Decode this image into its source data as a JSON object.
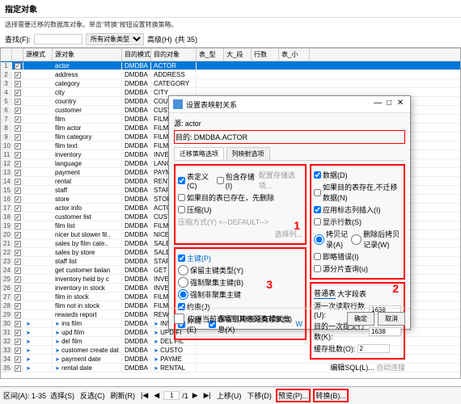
{
  "window": {
    "title": "指定对象",
    "subtitle": "选择需要迁移的数据库对象。单击\"转换\"按钮设置转换策略。"
  },
  "toolbar": {
    "find_label": "查找(F):",
    "scope_label": "所有对象类型",
    "advanced": "高级(H)",
    "count": "(共 35)"
  },
  "headers": [
    "",
    "",
    "源模式",
    "源对象",
    "目的模式",
    "目的对象",
    "表_型",
    "大_段",
    "行数",
    "表_小"
  ],
  "rows": [
    {
      "n": "1",
      "s": "s",
      "sm": "",
      "so": "actor",
      "dm": "DMDBA",
      "do": "ACTOR"
    },
    {
      "n": "2",
      "sm": "",
      "so": "address",
      "dm": "DMDBA",
      "do": "ADDRESS"
    },
    {
      "n": "3",
      "sm": "",
      "so": "category",
      "dm": "DMDBA",
      "do": "CATEGORY"
    },
    {
      "n": "4",
      "sm": "",
      "so": "city",
      "dm": "DMDBA",
      "do": "CITY"
    },
    {
      "n": "5",
      "sm": "",
      "so": "country",
      "dm": "DMDBA",
      "do": "COUNTRY"
    },
    {
      "n": "6",
      "sm": "",
      "so": "customer",
      "dm": "DMDBA",
      "do": "CUSTOMER"
    },
    {
      "n": "7",
      "sm": "",
      "so": "film",
      "dm": "DMDBA",
      "do": "FILM"
    },
    {
      "n": "8",
      "sm": "",
      "so": "film actor",
      "dm": "DMDBA",
      "do": "FILM A..."
    },
    {
      "n": "9",
      "sm": "",
      "so": "film category",
      "dm": "DMDBA",
      "do": "FILM C"
    },
    {
      "n": "10",
      "sm": "",
      "so": "film text",
      "dm": "DMDBA",
      "do": "FILM T"
    },
    {
      "n": "11",
      "sm": "",
      "so": "inventory",
      "dm": "DMDBA",
      "do": "INVENT"
    },
    {
      "n": "12",
      "sm": "",
      "so": "language",
      "dm": "DMDBA",
      "do": "LANGU"
    },
    {
      "n": "13",
      "sm": "",
      "so": "payment",
      "dm": "DMDBA",
      "do": "PAYME"
    },
    {
      "n": "14",
      "sm": "",
      "so": "rental",
      "dm": "DMDBA",
      "do": "RENTAL"
    },
    {
      "n": "15",
      "sm": "",
      "so": "staff",
      "dm": "DMDBA",
      "do": "STAFF"
    },
    {
      "n": "16",
      "sm": "",
      "so": "store",
      "dm": "DMDBA",
      "do": "STORE"
    },
    {
      "n": "17",
      "sm": "",
      "so": "actor info",
      "dm": "DMDBA",
      "do": "ACTOR"
    },
    {
      "n": "18",
      "sm": "",
      "so": "customer list",
      "dm": "DMDBA",
      "do": "CUSTO"
    },
    {
      "n": "19",
      "sm": "",
      "so": "film list",
      "dm": "DMDBA",
      "do": "FILM LI"
    },
    {
      "n": "20",
      "sm": "",
      "so": "nicer but slower fil..",
      "dm": "DMDBA",
      "do": "NICER"
    },
    {
      "n": "21",
      "sm": "",
      "so": "sales by film cate..",
      "dm": "DMDBA",
      "do": "SALES"
    },
    {
      "n": "22",
      "sm": "",
      "so": "sales by store",
      "dm": "DMDBA",
      "do": "SALES"
    },
    {
      "n": "23",
      "sm": "",
      "so": "staff list",
      "dm": "DMDBA",
      "do": "STAFF"
    },
    {
      "n": "24",
      "sm": "",
      "so": "get customer balan",
      "dm": "DMDBA",
      "do": "GET C"
    },
    {
      "n": "25",
      "sm": "",
      "so": "inventory held by c",
      "dm": "DMDBA",
      "do": "INVENT"
    },
    {
      "n": "26",
      "sm": "",
      "so": "inventory in stock",
      "dm": "DMDBA",
      "do": "INVENT"
    },
    {
      "n": "27",
      "sm": "",
      "so": "film in stock",
      "dm": "DMDBA",
      "do": "FILM I"
    },
    {
      "n": "28",
      "sm": "",
      "so": "film not in stock",
      "dm": "DMDBA",
      "do": "FILM N"
    },
    {
      "n": "29",
      "sm": "",
      "so": "rewards report",
      "dm": "DMDBA",
      "do": "REWAR"
    },
    {
      "n": "30",
      "sm": "",
      "so": "ins film",
      "dm": "DMDBA",
      "do": "INS FIL",
      "ar": "1"
    },
    {
      "n": "31",
      "sm": "",
      "so": "upd film",
      "dm": "DMDBA",
      "do": "UPD FI",
      "ar": "1"
    },
    {
      "n": "32",
      "sm": "",
      "so": "del film",
      "dm": "DMDBA",
      "do": "DEL FIL",
      "ar": "1"
    },
    {
      "n": "33",
      "sm": "",
      "so": "customer create dat",
      "dm": "DMDBA",
      "do": "CUSTO",
      "ar": "1"
    },
    {
      "n": "34",
      "sm": "",
      "so": "payment date",
      "dm": "DMDBA",
      "do": "PAYME",
      "ar": "1"
    },
    {
      "n": "35",
      "sm": "",
      "so": "rental date",
      "dm": "DMDBA",
      "do": "RENTAL",
      "ar": "1"
    }
  ],
  "dialog": {
    "title": "设置表映射关系",
    "source_label": "源:",
    "source_value": "actor",
    "dest_label": "目的:",
    "dest_value": "DMDBA.ACTOR",
    "tab1": "迁移策略选项",
    "tab2": "列映射选项",
    "g1": {
      "c1": "表定义(C)",
      "c2": "包含存储(I)",
      "c2b": "配置存储选项...",
      "c3": "如果目的表已存在，先删除",
      "c4": "压缩(U)",
      "c5": "压缩方式(Y)",
      "default": "<--DEFAULT-->",
      "c6": "选择列..."
    },
    "g2": {
      "t": "主键(P)",
      "c1": "保留主键类型(Y)",
      "c2": "强制聚集主键(B)",
      "c3": "强制非聚集主键",
      "c4": "约束(J)",
      "c5": "外键(E)",
      "c6": "保留引用表原有模式信息(X)",
      "c7": "W"
    },
    "g3": {
      "c1": "数据(D)",
      "c2": "如果目的表存在,不迁移数据(N)",
      "c3": "应用标志列插入(I)",
      "c4": "显示行数(S)",
      "c5": "拷贝记录(A)",
      "c5b": "删除后拷贝记录(W)",
      "c6": "即略错误(I)",
      "c7": "源分片查询(u)"
    },
    "g4": {
      "t1": "普通表",
      "t2": "大字段表",
      "f1": "源一次读取行数(U):",
      "v1": "1638",
      "f2": "目的一次提交行数(K):",
      "v2": "1638",
      "f3": "缓存批数(O):",
      "v3": "2"
    },
    "apply": "应用当前选项到其他同类对象(S)",
    "sql": "编辑SQL(L)...",
    "auto": "自动连接",
    "ok": "确定",
    "cancel": "取消"
  },
  "footer": {
    "range": "区间(A): 1-35",
    "sel": "选择(S)",
    "unsel": "反选(C)",
    "refresh": "刷新(R)",
    "first": "|◀",
    "prev": "◀",
    "page": "1",
    "of": "/1",
    "next": "▶",
    "last": "▶|",
    "up": "上移(U)",
    "down": "下移(D)",
    "preview": "预览(P)...",
    "convert": "转换(B)..."
  }
}
